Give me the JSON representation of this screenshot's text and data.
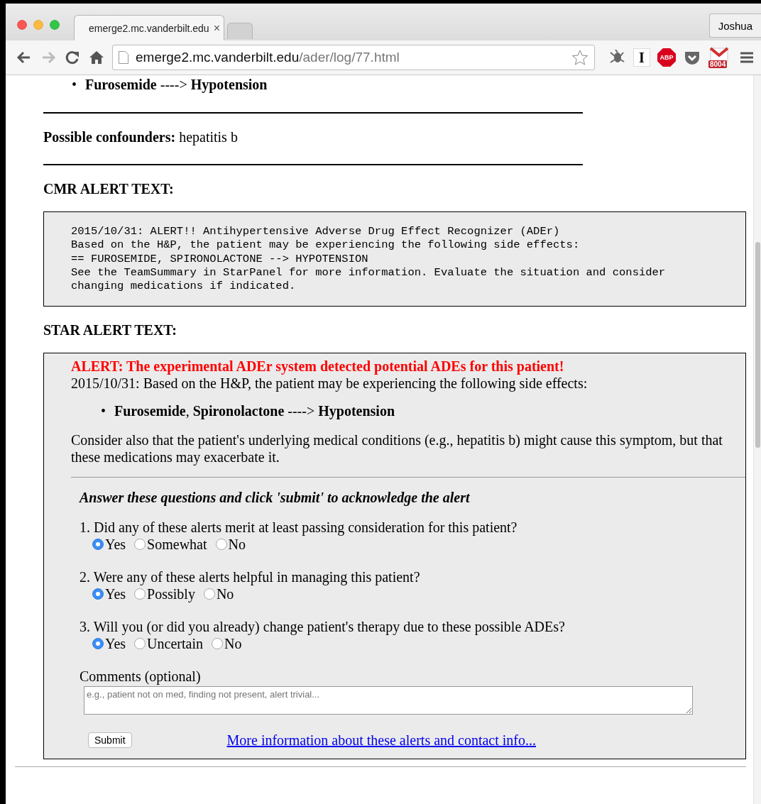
{
  "browser": {
    "tabs": [
      {
        "title": "emerge2.mc.vanderbilt.edu",
        "selected": true,
        "close": "×"
      },
      {
        "selected": false
      }
    ],
    "profile": "Joshua",
    "address": {
      "host": "emerge2.mc.vanderbilt.edu",
      "path": "/ader/log/77.html"
    },
    "extensions": [
      {
        "kind": "bug"
      },
      {
        "kind": "letter",
        "text": "I"
      },
      {
        "kind": "abp",
        "text": "ABP"
      },
      {
        "kind": "pocket"
      },
      {
        "kind": "mail",
        "text": "8004"
      }
    ]
  },
  "page": {
    "top_bullets": [
      {
        "marker": "•",
        "text": "**Furosemide** ----> **Hypotension**"
      }
    ],
    "confounders": "**Possible confounders:** hepatitis b",
    "cmr_heading": "CMR ALERT TEXT:",
    "cmr_lines": [
      "2015/10/31: ALERT!! Antihypertensive Adverse Drug Effect Recognizer (ADEr)",
      "Based on the H&P, the patient may be experiencing the following side effects:",
      "== FUROSEMIDE, SPIRONOLACTONE --> HYPOTENSION",
      "See the TeamSummary in StarPanel for more information. Evaluate the situation and consider",
      "changing medications if indicated."
    ],
    "star_heading": "STAR ALERT TEXT:",
    "star": {
      "alert": "ALERT: The experimental ADEr system detected potential ADEs for this patient!",
      "intro": "2015/10/31: Based on the H&P, the patient may be experiencing the following side effects:",
      "bullets": [
        {
          "marker": "•",
          "text": "**Furosemide**, **Spironolactone** ----> **Hypotension**"
        }
      ],
      "note": "Consider also that the patient's underlying medical conditions (e.g., hepatitis b) might cause this symptom, but that these medications may exacerbate it.",
      "instruction": "Answer these questions and click 'submit' to acknowledge the alert",
      "questions": [
        {
          "text": "1. Did any of these alerts merit at least passing consideration for this patient?",
          "options": [
            {
              "label": "Yes",
              "selected": true
            },
            {
              "label": "Somewhat",
              "selected": false
            },
            {
              "label": "No",
              "selected": false
            }
          ]
        },
        {
          "text": "2. Were any of these alerts helpful in managing this patient?",
          "options": [
            {
              "label": "Yes",
              "selected": true
            },
            {
              "label": "Possibly",
              "selected": false
            },
            {
              "label": "No",
              "selected": false
            }
          ]
        },
        {
          "text": "3. Will you (or did you already) change patient's therapy due to these possible ADEs?",
          "options": [
            {
              "label": "Yes",
              "selected": true
            },
            {
              "label": "Uncertain",
              "selected": false
            },
            {
              "label": "No",
              "selected": false
            }
          ]
        }
      ],
      "comments_label": "Comments (optional)",
      "comments": {
        "placeholder": "e.g., patient not on med, finding not present, alert trivial..."
      },
      "submit": "Submit",
      "link": "More information about these alerts and contact info..."
    }
  }
}
